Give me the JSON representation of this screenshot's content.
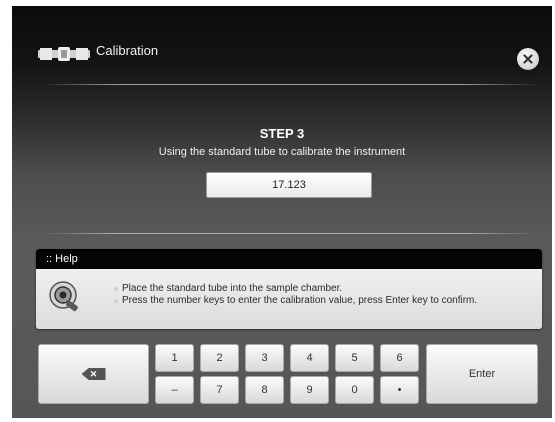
{
  "window": {
    "title": "Calibration"
  },
  "icons": {
    "title_icon": "tube-icon",
    "close": "close-icon",
    "help_icon": "sample-chamber-icon",
    "backspace": "backspace-icon"
  },
  "step": {
    "title": "STEP 3",
    "subtitle": "Using the standard tube to calibrate the instrument",
    "value": "17.123"
  },
  "help": {
    "header": ":: Help",
    "items": [
      "Place the standard tube into the sample chamber.",
      "Press the number keys to enter the calibration value, press Enter key to confirm."
    ]
  },
  "keypad": {
    "row1": [
      "1",
      "2",
      "3",
      "4",
      "5",
      "6"
    ],
    "row2": [
      "–",
      "7",
      "8",
      "9",
      "0",
      "•"
    ],
    "enter": "Enter",
    "backspace_symbol": "✕"
  }
}
